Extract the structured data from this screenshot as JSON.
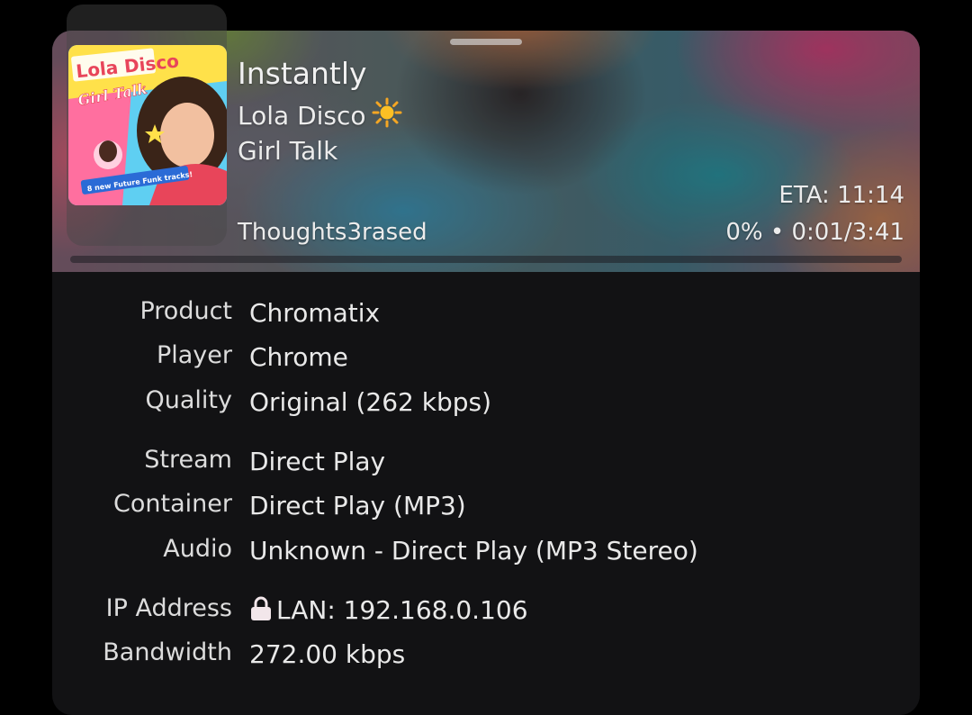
{
  "now_playing": {
    "title": "Instantly",
    "artist": "Lola Disco",
    "album": "Girl Talk",
    "user": "Thoughts3rased",
    "eta": "ETA: 11:14",
    "progress_text": "0% • 0:01/3:41",
    "progress_fraction": 0.0,
    "artwork": {
      "line1": "Lola Disco",
      "line2": "Girl Talk",
      "badge": "8 new Future Funk tracks!"
    }
  },
  "details": [
    {
      "label": "Product",
      "value": "Chromatix"
    },
    {
      "label": "Player",
      "value": "Chrome"
    },
    {
      "label": "Quality",
      "value": "Original (262 kbps)"
    },
    {
      "label": "Stream",
      "value": "Direct Play"
    },
    {
      "label": "Container",
      "value": "Direct Play (MP3)"
    },
    {
      "label": "Audio",
      "value": "Unknown - Direct Play (MP3 Stereo)"
    },
    {
      "label": "IP Address",
      "value": "LAN: 192.168.0.106",
      "icon": "lock-icon"
    },
    {
      "label": "Bandwidth",
      "value": "272.00 kbps"
    }
  ],
  "colors": {
    "accent": "#e5a00d",
    "background": "#000000",
    "card": "#121214"
  }
}
